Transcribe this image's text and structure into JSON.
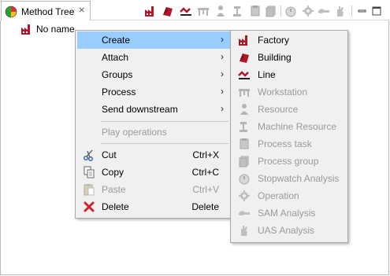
{
  "view": {
    "tab_title": "Method Tree",
    "close_glyph": "⨯",
    "toolbar_icons": [
      "factory-icon",
      "building-icon",
      "line-icon",
      "workstation-icon",
      "resource-icon",
      "machine-resource-icon",
      "process-task-icon",
      "process-group-icon",
      "stopwatch-icon",
      "operation-icon",
      "sam-analysis-icon",
      "uas-analysis-icon",
      "minimize-icon",
      "maximize-icon"
    ]
  },
  "tree": {
    "root_label": "No name"
  },
  "context_menu": {
    "items": [
      {
        "label": "Create",
        "submenu": true
      },
      {
        "label": "Attach",
        "submenu": true
      },
      {
        "label": "Groups",
        "submenu": true
      },
      {
        "label": "Process",
        "submenu": true
      },
      {
        "label": "Send downstream",
        "submenu": true
      },
      {
        "label": "Play operations",
        "disabled": true
      },
      {
        "label": "Cut",
        "shortcut": "Ctrl+X"
      },
      {
        "label": "Copy",
        "shortcut": "Ctrl+C"
      },
      {
        "label": "Paste",
        "shortcut": "Ctrl+V",
        "disabled": true
      },
      {
        "label": "Delete",
        "shortcut": "Delete"
      }
    ],
    "arrow_glyph": "›"
  },
  "create_submenu": {
    "items": [
      {
        "label": "Factory"
      },
      {
        "label": "Building"
      },
      {
        "label": "Line"
      },
      {
        "label": "Workstation",
        "disabled": true
      },
      {
        "label": "Resource",
        "disabled": true
      },
      {
        "label": "Machine Resource",
        "disabled": true
      },
      {
        "label": "Process task",
        "disabled": true
      },
      {
        "label": "Process group",
        "disabled": true
      },
      {
        "label": "Stopwatch Analysis",
        "disabled": true
      },
      {
        "label": "Operation",
        "disabled": true
      },
      {
        "label": "SAM Analysis",
        "disabled": true
      },
      {
        "label": "UAS Analysis",
        "disabled": true
      }
    ]
  },
  "colors": {
    "highlight": "#99ccff",
    "menu_bg": "#f0f0f0",
    "disabled_text": "#9a9a9a",
    "icon_red": "#c0182b"
  }
}
